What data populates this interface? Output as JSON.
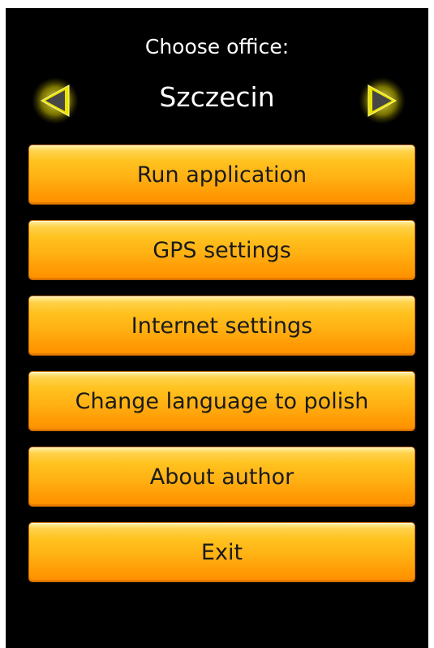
{
  "header": {
    "prompt": "Choose office:",
    "selected_office": "Szczecin",
    "prev_icon": "left-triangle-arrow",
    "next_icon": "right-triangle-arrow"
  },
  "menu": {
    "items": [
      {
        "label": "Run application"
      },
      {
        "label": "GPS settings"
      },
      {
        "label": "Internet settings"
      },
      {
        "label": "Change language to polish"
      },
      {
        "label": "About author"
      },
      {
        "label": "Exit"
      }
    ]
  },
  "colors": {
    "background": "#000000",
    "button_orange": "#ffb114",
    "arrow_yellow": "#e8e000"
  }
}
